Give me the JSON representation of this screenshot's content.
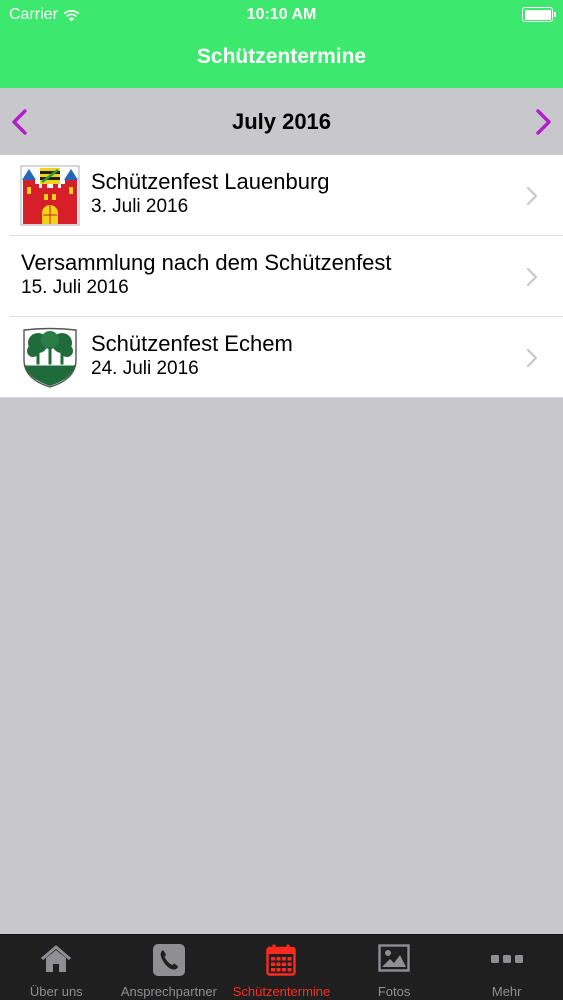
{
  "status_bar": {
    "carrier": "Carrier",
    "time": "10:10 AM"
  },
  "nav": {
    "title": "Schützentermine"
  },
  "month_selector": {
    "title": "July 2016",
    "prev_icon": "chevron-left-icon",
    "next_icon": "chevron-right-icon",
    "arrow_color": "#b01fc8"
  },
  "events": [
    {
      "title": "Schützenfest Lauenburg",
      "date": "3. Juli 2016",
      "icon": "lauenburg-crest-icon"
    },
    {
      "title": "Versammlung nach dem Schützenfest",
      "date": "15. Juli 2016"
    },
    {
      "title": "Schützenfest Echem",
      "date": "24. Juli 2016",
      "icon": "echem-crest-icon"
    }
  ],
  "tabs": [
    {
      "label": "Über uns",
      "icon": "home-icon"
    },
    {
      "label": "Ansprechpartner",
      "icon": "phone-icon"
    },
    {
      "label": "Schützentermine",
      "icon": "calendar-icon",
      "active": true
    },
    {
      "label": "Fotos",
      "icon": "photo-icon"
    },
    {
      "label": "Mehr",
      "icon": "more-icon"
    }
  ],
  "colors": {
    "header": "#3de86e",
    "active_tab": "#ff2a1f",
    "inactive_tab": "#8e8e93"
  }
}
